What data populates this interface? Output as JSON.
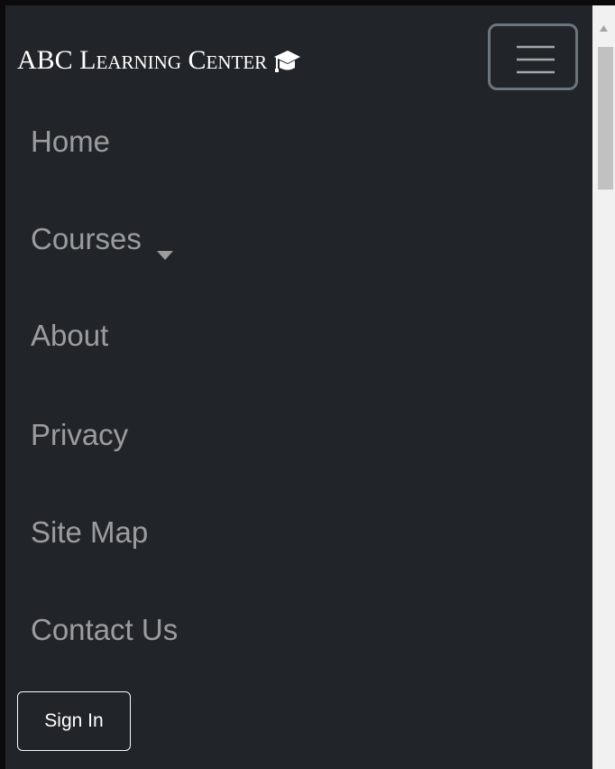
{
  "brand": {
    "title": "ABC Learning Center",
    "icon": "graduation-cap-icon"
  },
  "toggler": {
    "icon": "hamburger-icon"
  },
  "nav": {
    "items": [
      {
        "label": "Home"
      },
      {
        "label": "Courses",
        "has_dropdown": true,
        "icon": "caret-down-icon"
      },
      {
        "label": "About"
      },
      {
        "label": "Privacy"
      },
      {
        "label": "Site Map"
      },
      {
        "label": "Contact Us"
      }
    ]
  },
  "auth": {
    "signin_label": "Sign In"
  },
  "colors": {
    "navbar_bg": "#212529",
    "nav_link": "rgba(255,255,255,0.55)",
    "brand_text": "#ffffff",
    "toggler_border": "#6c757d",
    "scrollbar_track": "#f1f1f1",
    "scrollbar_thumb": "#c1c1c1"
  }
}
